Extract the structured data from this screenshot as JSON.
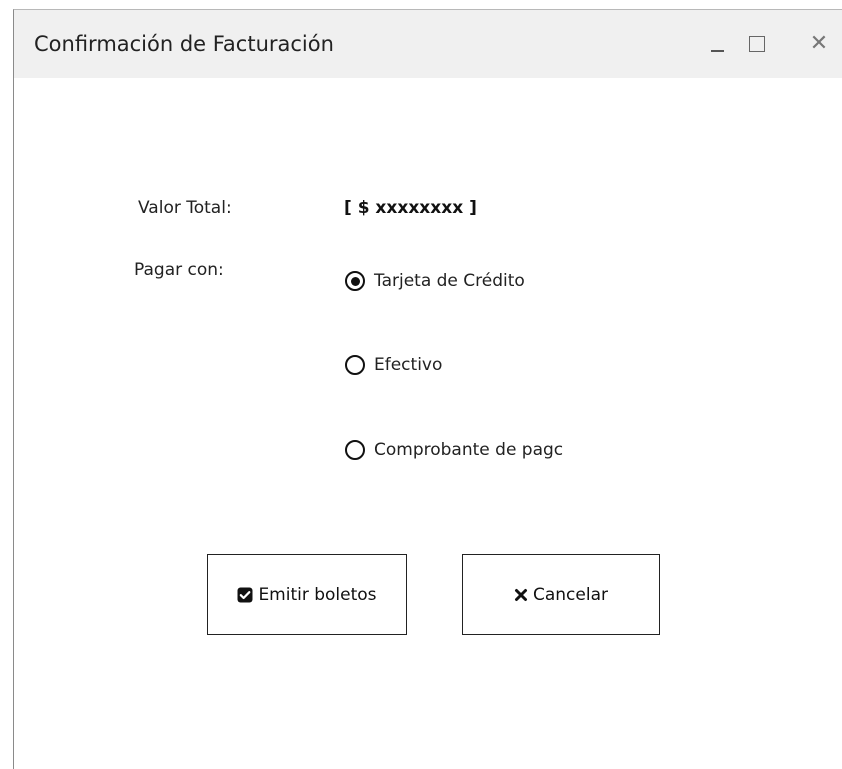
{
  "window": {
    "title": "Confirmación de Facturación",
    "controls": {
      "minimize_icon": "minimize-icon",
      "maximize_icon": "maximize-icon",
      "close_icon": "close-icon"
    }
  },
  "form": {
    "total_label": "Valor Total:",
    "total_value": "[ $ xxxxxxxx ]",
    "pay_label": "Pagar con:",
    "payment_options": [
      {
        "label": "Tarjeta de Crédito",
        "selected": true
      },
      {
        "label": "Efectivo",
        "selected": false
      },
      {
        "label": "Comprobante de pagc",
        "selected": false
      }
    ]
  },
  "buttons": {
    "emit_label": "Emitir boletos",
    "emit_icon": "checkbox-checked-icon",
    "cancel_label": "Cancelar",
    "cancel_icon": "x-icon"
  }
}
